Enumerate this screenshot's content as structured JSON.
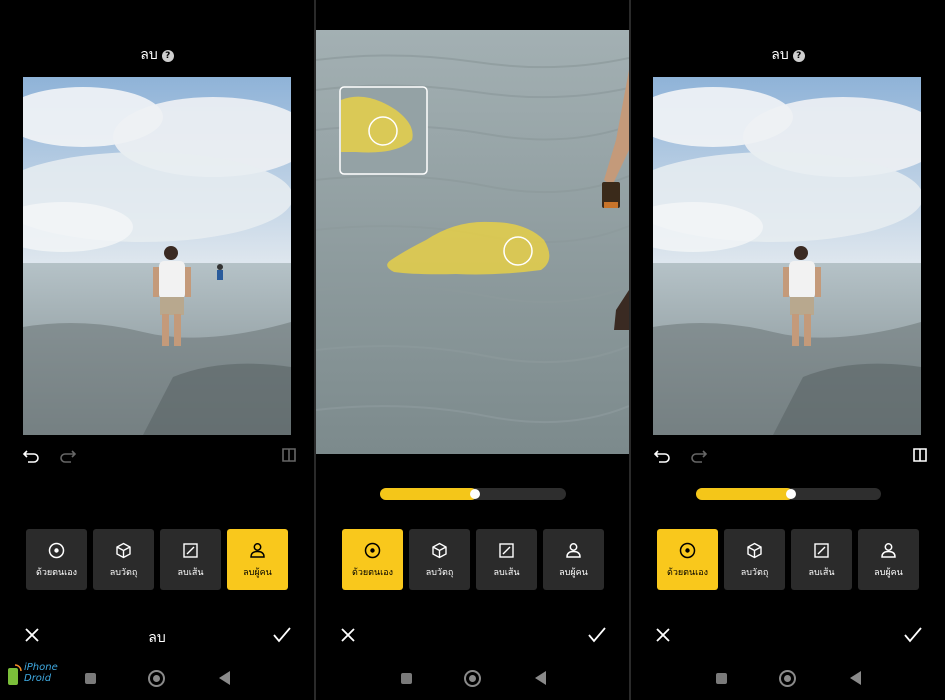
{
  "screens": [
    {
      "title": "ลบ",
      "tools": [
        {
          "label": "ด้วยตนเอง",
          "icon": "target-icon",
          "active": false
        },
        {
          "label": "ลบวัตถุ",
          "icon": "cube-icon",
          "active": false
        },
        {
          "label": "ลบเส้น",
          "icon": "line-erase-icon",
          "active": false
        },
        {
          "label": "ลบผู้คน",
          "icon": "person-icon",
          "active": true
        }
      ],
      "action_title": "ลบ",
      "compare_enabled": false
    },
    {
      "brush_size": 0.5,
      "tools": [
        {
          "label": "ด้วยตนเอง",
          "icon": "target-icon",
          "active": true
        },
        {
          "label": "ลบวัตถุ",
          "icon": "cube-icon",
          "active": false
        },
        {
          "label": "ลบเส้น",
          "icon": "line-erase-icon",
          "active": false
        },
        {
          "label": "ลบผู้คน",
          "icon": "person-icon",
          "active": false
        }
      ]
    },
    {
      "title": "ลบ",
      "brush_size": 0.5,
      "tools": [
        {
          "label": "ด้วยตนเอง",
          "icon": "target-icon",
          "active": true
        },
        {
          "label": "ลบวัตถุ",
          "icon": "cube-icon",
          "active": false
        },
        {
          "label": "ลบเส้น",
          "icon": "line-erase-icon",
          "active": false
        },
        {
          "label": "ลบผู้คน",
          "icon": "person-icon",
          "active": false
        }
      ],
      "compare_enabled": true
    }
  ],
  "watermark": {
    "line1": "iPhone",
    "line2": "Droid"
  },
  "colors": {
    "accent": "#f9c81c",
    "tile": "#2b2b2b",
    "mask": "#f2d53c"
  }
}
